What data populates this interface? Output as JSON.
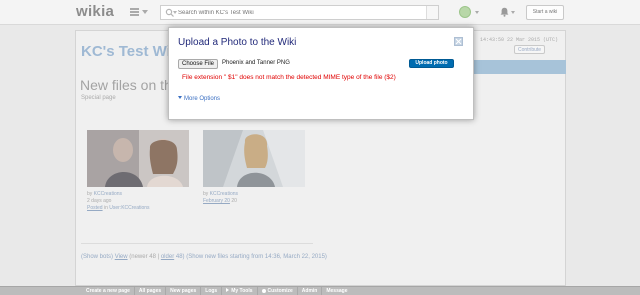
{
  "topbar": {
    "logo": "wikia",
    "search_placeholder": "Search within KC's Test Wiki",
    "start_wiki_label": "Start a wiki"
  },
  "page": {
    "wiki_title": "KC's Test Wi",
    "timestamp": "14:43:50 22 Mar 2015 (UTC)",
    "contribute_label": "Contribute",
    "heading": "New files on th",
    "subheading": "Special page",
    "files": [
      {
        "by": "by",
        "user": "KCCreations",
        "age": "2 days ago",
        "posted": "Posted",
        "in": " in ",
        "location": "User:KCCreations"
      },
      {
        "by": "by",
        "user": "KCCreations",
        "age": "February 20",
        "posted": "",
        "in": "",
        "location": ""
      }
    ],
    "pager": {
      "show_bots_prefix": "(Show bots) ",
      "view": "View",
      "newer": " (newer 48 | ",
      "older": "older",
      "rest": " 48) (Show new files starting from 14:36, March 22, 2015)"
    }
  },
  "modal": {
    "title": "Upload a Photo to the Wiki",
    "choose_file_label": "Choose File",
    "file_name": "Phoenix and Tanner PNG",
    "upload_label": "Upload photo",
    "error": "File extension \" $1\" does not match the detected MIME type of the file ($2)",
    "more_options": "More Options"
  },
  "toolbar": {
    "items": [
      "Create a new page",
      "All pages",
      "New pages",
      "Logs",
      "My Tools",
      "Customize",
      "Admin",
      "Message"
    ]
  },
  "icons": [
    "menu-icon",
    "search-icon",
    "avatar",
    "bell-icon",
    "close-icon",
    "chevron-down-icon",
    "gear-icon"
  ],
  "colors": {
    "modal_title": "#222a7a",
    "error": "#e00000",
    "upload_button": "#006cb0",
    "link": "#3a6fc2"
  }
}
